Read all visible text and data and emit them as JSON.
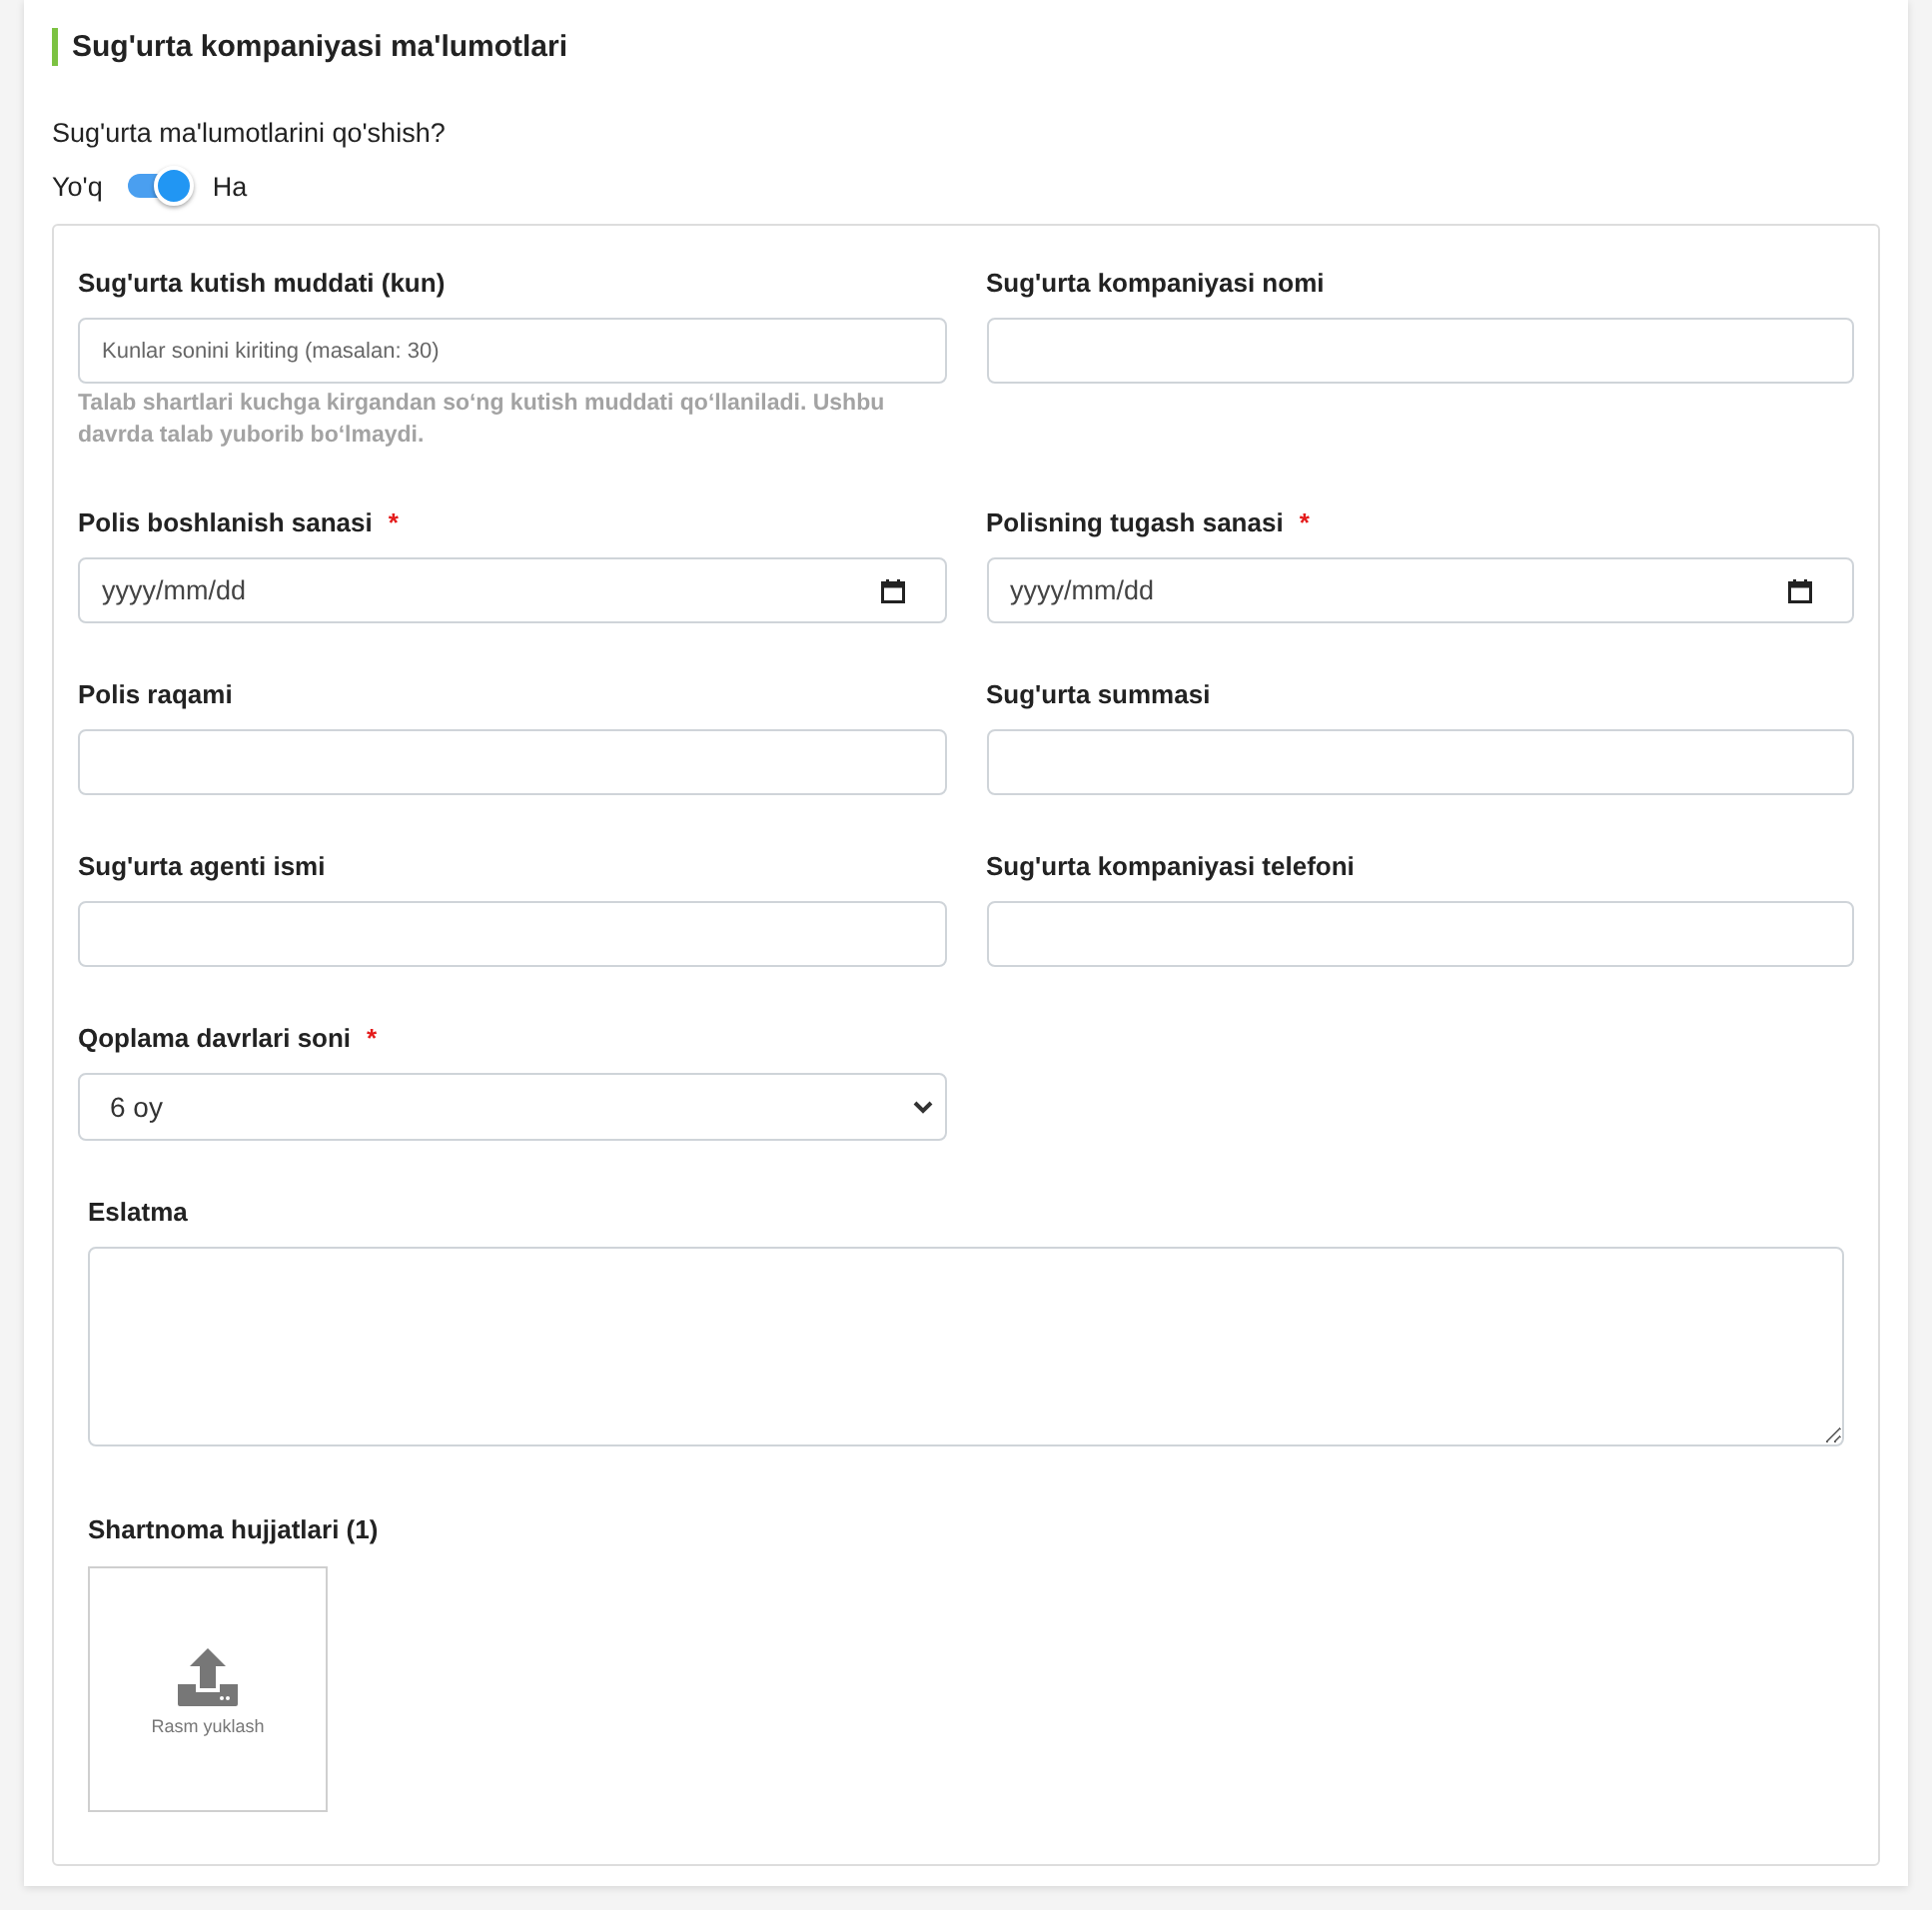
{
  "section": {
    "title": "Sug'urta kompaniyasi ma'lumotlari"
  },
  "toggle": {
    "question": "Sug'urta ma'lumotlarini qo'shish?",
    "off_label": "Yo'q",
    "on_label": "Ha",
    "on": true
  },
  "fields": [
    {
      "kind": "text",
      "label": "Sug'urta kutish muddati (kun)",
      "placeholder": "Kunlar sonini kiriting (masalan: 30)",
      "help": "Talab shartlari kuchga kirgandan so‘ng kutish muddati qo‘llaniladi. Ushbu davrda talab yuborib bo‘lmaydi."
    },
    {
      "kind": "text",
      "label": "Sug'urta kompaniyasi nomi"
    },
    {
      "kind": "date",
      "label": "Polis boshlanish sanasi",
      "required_mark": "*",
      "placeholder": "yyyy/mm/dd"
    },
    {
      "kind": "date",
      "label": "Polisning tugash sanasi",
      "required_mark": "*",
      "placeholder": "yyyy/mm/dd"
    },
    {
      "kind": "text",
      "label": "Polis raqami"
    },
    {
      "kind": "text",
      "label": "Sug'urta summasi"
    },
    {
      "kind": "text",
      "label": "Sug'urta agenti ismi"
    },
    {
      "kind": "text",
      "label": "Sug'urta kompaniyasi telefoni"
    },
    {
      "kind": "select",
      "label": "Qoplama davrlari soni",
      "required_mark": "*",
      "value": "6 oy"
    }
  ],
  "note": {
    "label": "Eslatma"
  },
  "documents": {
    "label": "Shartnoma hujjatlari (1)",
    "upload_label": "Rasm yuklash"
  }
}
